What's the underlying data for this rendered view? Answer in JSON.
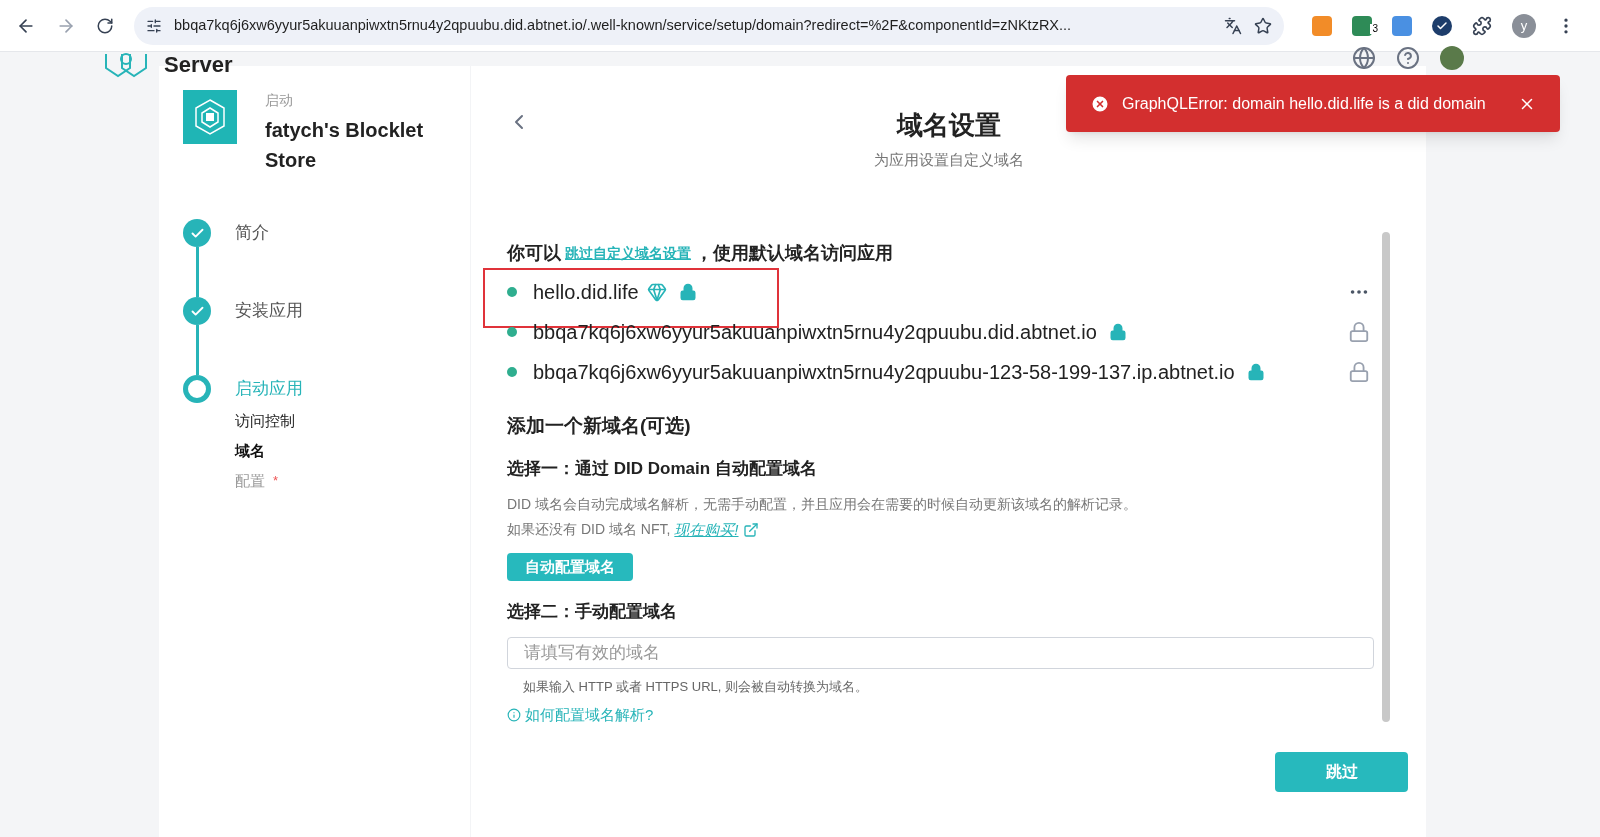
{
  "browser": {
    "url": "bbqa7kq6j6xw6yyur5akuuanpiwxtn5rnu4y2qpuubu.did.abtnet.io/.well-known/service/setup/domain?redirect=%2F&componentId=zNKtzRX...",
    "extension_badge": "3",
    "profile_initial": "y"
  },
  "header": {
    "brand": "Server"
  },
  "app": {
    "caption": "启动",
    "name": "fatych's Blocklet Store"
  },
  "steps": [
    {
      "label": "简介",
      "completed": true,
      "active": false
    },
    {
      "label": "安装应用",
      "completed": true,
      "active": false
    },
    {
      "label": "启动应用",
      "completed": false,
      "active": true,
      "children": [
        {
          "label": "访问控制",
          "selected": false,
          "disabled": false,
          "required": false
        },
        {
          "label": "域名",
          "selected": true,
          "disabled": false,
          "required": false
        },
        {
          "label": "配置",
          "selected": false,
          "disabled": true,
          "required": true,
          "mark": "*"
        }
      ]
    }
  ],
  "page": {
    "title": "域名设置",
    "subtitle": "为应用设置自定义域名"
  },
  "intro": {
    "before": "你可以",
    "link": "跳过自定义域名设置",
    "after": "，使用默认域名访问应用"
  },
  "domains": [
    {
      "name": "hello.did.life",
      "kind": "did",
      "secure": true,
      "highlighted": true,
      "menu": true
    },
    {
      "name": "bbqa7kq6j6xw6yyur5akuuanpiwxtn5rnu4y2qpuubu.did.abtnet.io",
      "kind": "default",
      "secure": true,
      "highlighted": false,
      "menu": false
    },
    {
      "name": "bbqa7kq6j6xw6yyur5akuuanpiwxtn5rnu4y2qpuubu-123-58-199-137.ip.abtnet.io",
      "kind": "default",
      "secure": true,
      "highlighted": false,
      "menu": false
    }
  ],
  "add": {
    "title": "添加一个新域名(可选)",
    "option1": "选择一：通过 DID Domain 自动配置域名",
    "description": "DID 域名会自动完成域名解析，无需手动配置，并且应用会在需要的时候自动更新该域名的解析记录。",
    "nft_note": "如果还没有 DID 域名 NFT,",
    "buy_link": "现在购买!",
    "auto_button": "自动配置域名",
    "option2": "选择二：手动配置域名",
    "placeholder": "请填写有效的域名",
    "hint": "如果输入 HTTP 或者 HTTPS URL, 则会被自动转换为域名。",
    "help_link": "如何配置域名解析?"
  },
  "skip_button": "跳过",
  "toast": {
    "message": "GraphQLError: domain hello.did.life is a did domain"
  }
}
